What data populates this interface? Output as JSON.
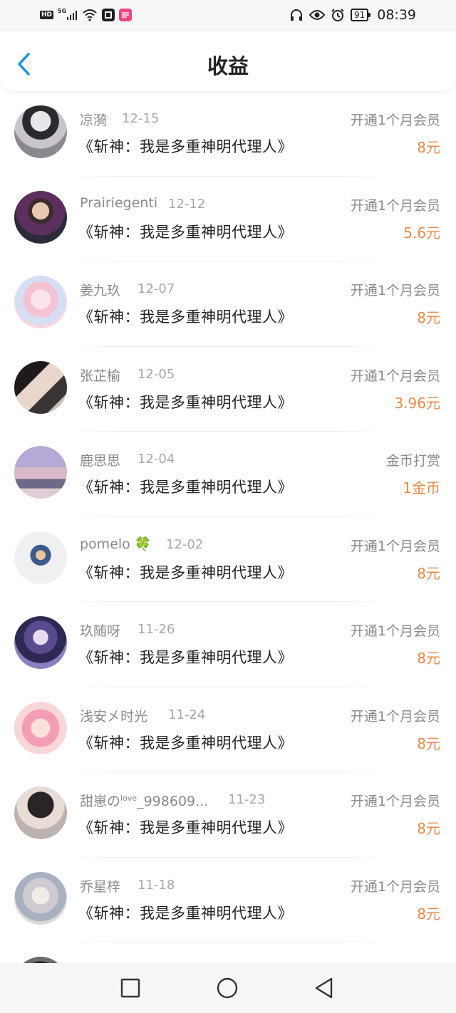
{
  "status_bar": {
    "left_icons": [
      "hd-icon",
      "signal-5g-icon",
      "wifi-icon",
      "app-icon",
      "app-pink-icon"
    ],
    "network": "5G",
    "hd": "HD",
    "battery": "91",
    "time": "08:39"
  },
  "header": {
    "title": "收益",
    "back_icon": "chevron-left-icon",
    "accent_color": "#2196e6"
  },
  "colors": {
    "amount": "#e8894a",
    "muted": "#8a8a8a",
    "text": "#222222"
  },
  "rows": [
    {
      "name": "凉漪",
      "date": "12-15",
      "book": "《斩神：我是多重神明代理人》",
      "type": "开通1个月会员",
      "amount": "8元"
    },
    {
      "name": "Prairiegenti",
      "date": "12-12",
      "book": "《斩神：我是多重神明代理人》",
      "type": "开通1个月会员",
      "amount": "5.6元"
    },
    {
      "name": "姜九玖",
      "date": "12-07",
      "book": "《斩神：我是多重神明代理人》",
      "type": "开通1个月会员",
      "amount": "8元"
    },
    {
      "name": "张芷榆",
      "date": "12-05",
      "book": "《斩神：我是多重神明代理人》",
      "type": "开通1个月会员",
      "amount": "3.96元"
    },
    {
      "name": "鹿思思",
      "date": "12-04",
      "book": "《斩神：我是多重神明代理人》",
      "type": "金币打赏",
      "amount": "1金币"
    },
    {
      "name": "pomelo 🍀",
      "date": "12-02",
      "book": "《斩神：我是多重神明代理人》",
      "type": "开通1个月会员",
      "amount": "8元"
    },
    {
      "name": "玖随呀",
      "date": "11-26",
      "book": "《斩神：我是多重神明代理人》",
      "type": "开通1个月会员",
      "amount": "8元"
    },
    {
      "name": "浅安㐅时光",
      "date": "11-24",
      "book": "《斩神：我是多重神明代理人》",
      "type": "开通1个月会员",
      "amount": "8元"
    },
    {
      "name_prefix": "甜崽の",
      "name_sup": "love",
      "name_suffix": "_998609...",
      "date": "11-23",
      "book": "《斩神：我是多重神明代理人》",
      "type": "开通1个月会员",
      "amount": "8元"
    },
    {
      "name": "乔星梓",
      "date": "11-18",
      "book": "《斩神：我是多重神明代理人》",
      "type": "开通1个月会员",
      "amount": "8元"
    }
  ],
  "nav_bar": {
    "icons": [
      "square-recents-icon",
      "circle-home-icon",
      "triangle-back-icon"
    ]
  }
}
